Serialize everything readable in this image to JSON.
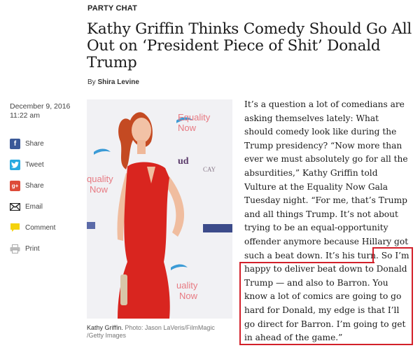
{
  "article": {
    "kicker": "PARTY CHAT",
    "headline": "Kathy Griffin Thinks Comedy Should Go All Out on ‘President Piece of Shit’ Donald Trump",
    "byline_prefix": "By ",
    "author": "Shira Levine",
    "date": "December 9, 2016",
    "time": "11:22 am",
    "paragraph_before": "It’s a question a lot of comedians are asking themselves lately: What should comedy look like during the Trump presidency? “Now more than ever we must absolutely go for all the absurdities,” Kathy Griffin told Vulture at the Equality Now Gala Tuesday night. “For me, that’s Trump and all things Trump. It’s not about trying to be an equal-opportunity offender anymore because Hillary got such a beat down. It’s his turn.",
    "paragraph_highlighted": " So I’m happy to deliver beat down to Donald Trump — and also to Barron. You know a lot of comics are going to go hard for Donald, my edge is that I’ll go direct for Barron. I’m going to get in ahead of the game.”"
  },
  "share": {
    "items": [
      {
        "label": "Share",
        "icon": "facebook-icon",
        "glyph": "f"
      },
      {
        "label": "Tweet",
        "icon": "twitter-icon",
        "glyph": "t"
      },
      {
        "label": "Share",
        "icon": "google-plus-icon",
        "glyph": "g+"
      },
      {
        "label": "Email",
        "icon": "email-icon",
        "glyph": ""
      },
      {
        "label": "Comment",
        "icon": "comment-icon",
        "glyph": ""
      },
      {
        "label": "Print",
        "icon": "print-icon",
        "glyph": ""
      }
    ]
  },
  "photo": {
    "caption_name": "Kathy Griffin.",
    "caption_credit": " Photo: Jason LaVeris/FilmMagic /Getty Images",
    "backdrop_text_1": "Equality",
    "backdrop_text_2": "Now",
    "backdrop_text_3": "quality",
    "backdrop_text_4": "Now",
    "backdrop_text_5": "uality",
    "backdrop_text_6": "Now",
    "backdrop_text_7": "CAY",
    "backdrop_text_8": "ud"
  },
  "colors": {
    "highlight_border": "#d3202a",
    "dress": "#d9251f",
    "facebook": "#3b5998",
    "twitter": "#29a9e0",
    "google_plus": "#dd4b39"
  }
}
